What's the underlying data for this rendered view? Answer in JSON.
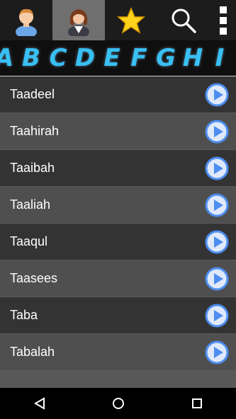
{
  "toolbar": {
    "tabs": [
      {
        "icon": "boy-avatar-icon",
        "active": false
      },
      {
        "icon": "girl-avatar-icon",
        "active": true
      },
      {
        "icon": "star-icon",
        "active": false
      },
      {
        "icon": "search-icon",
        "active": false
      },
      {
        "icon": "overflow-menu-icon",
        "active": false
      }
    ]
  },
  "alphabet": [
    "A",
    "B",
    "C",
    "D",
    "E",
    "F",
    "G",
    "H",
    "I"
  ],
  "names": [
    "Taadeel",
    "Taahirah",
    "Taaibah",
    "Taaliah",
    "Taaqul",
    "Taasees",
    "Taba",
    "Tabalah"
  ],
  "colors": {
    "toolbar_bg": "#1c1c1c",
    "active_tab_bg": "#6f6f6f",
    "letter_color": "#39c0f2",
    "row_dark": "#333333",
    "row_light": "#4f4f4f",
    "play_blue": "#4d8ef0"
  },
  "navbar": [
    "back-icon",
    "home-icon",
    "recents-icon"
  ]
}
